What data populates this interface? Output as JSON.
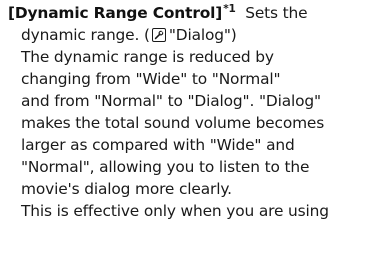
{
  "heading": {
    "title": "[Dynamic Range Control]",
    "footnote_mark": "*1"
  },
  "lines": [
    "Sets the",
    "dynamic range. (",
    "\"Dialog\")",
    "The dynamic range is reduced by",
    "changing from \"Wide\" to \"Normal\"",
    "and from \"Normal\" to \"Dialog\". \"Dialog\"",
    "makes the total sound volume becomes",
    "larger as compared with \"Wide\" and",
    "\"Normal\", allowing you to listen to the",
    "movie's dialog more clearly.",
    "This is effective only when you are using"
  ],
  "icons": {
    "settings": "wrench-icon"
  }
}
